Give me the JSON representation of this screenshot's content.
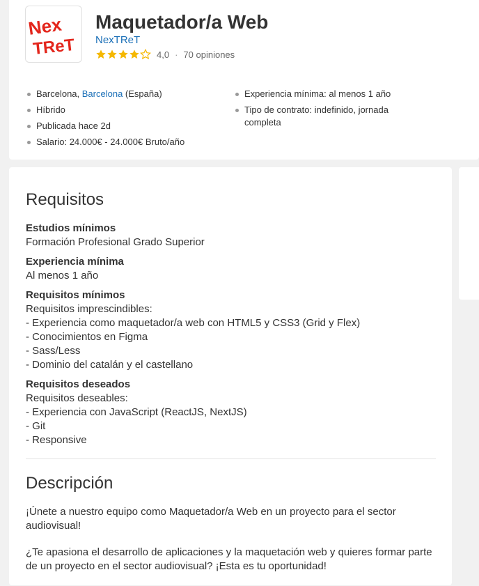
{
  "header": {
    "job_title": "Maquetador/a Web",
    "company": "NexTReT",
    "logo_text_top": "Nex",
    "logo_text_bottom": "TReT",
    "rating_value": "4,0",
    "rating_stars": 4,
    "reviews": "70 opiniones",
    "separator": "·"
  },
  "facts": {
    "location_city": "Barcelona, ",
    "location_province": "Barcelona",
    "location_country": " (España)",
    "modality": "Híbrido",
    "published": "Publicada hace 2d",
    "salary": "Salario: 24.000€ - 24.000€ Bruto/año",
    "experience": "Experiencia mínima: al menos 1 año",
    "contract": "Tipo de contrato: indefinido, jornada completa"
  },
  "requirements": {
    "title": "Requisitos",
    "studies_label": "Estudios mínimos",
    "studies_value": "Formación Profesional Grado Superior",
    "experience_label": "Experiencia mínima",
    "experience_value": "Al menos 1 año",
    "minimum_label": "Requisitos mínimos",
    "minimum_lines": [
      "Requisitos imprescindibles:",
      "- Experiencia como maquetador/a web con HTML5 y CSS3 (Grid y Flex)",
      "- Conocimientos en Figma",
      "- Sass/Less",
      "- Dominio del catalán y el castellano"
    ],
    "desired_label": "Requisitos deseados",
    "desired_lines": [
      "Requisitos deseables:",
      "- Experiencia con JavaScript (ReactJS, NextJS)",
      "- Git",
      "- Responsive"
    ]
  },
  "description": {
    "title": "Descripción",
    "paragraphs": [
      "¡Únete a nuestro equipo como Maquetador/a Web en un proyecto para el sector audiovisual!",
      "¿Te apasiona el desarrollo de aplicaciones y la maquetación web y quieres formar parte de un proyecto en el sector audiovisual? ¡Esta es tu oportunidad!"
    ]
  },
  "colors": {
    "link": "#1a6fb7",
    "star": "#f5b800",
    "logo_red": "#e3251b"
  }
}
